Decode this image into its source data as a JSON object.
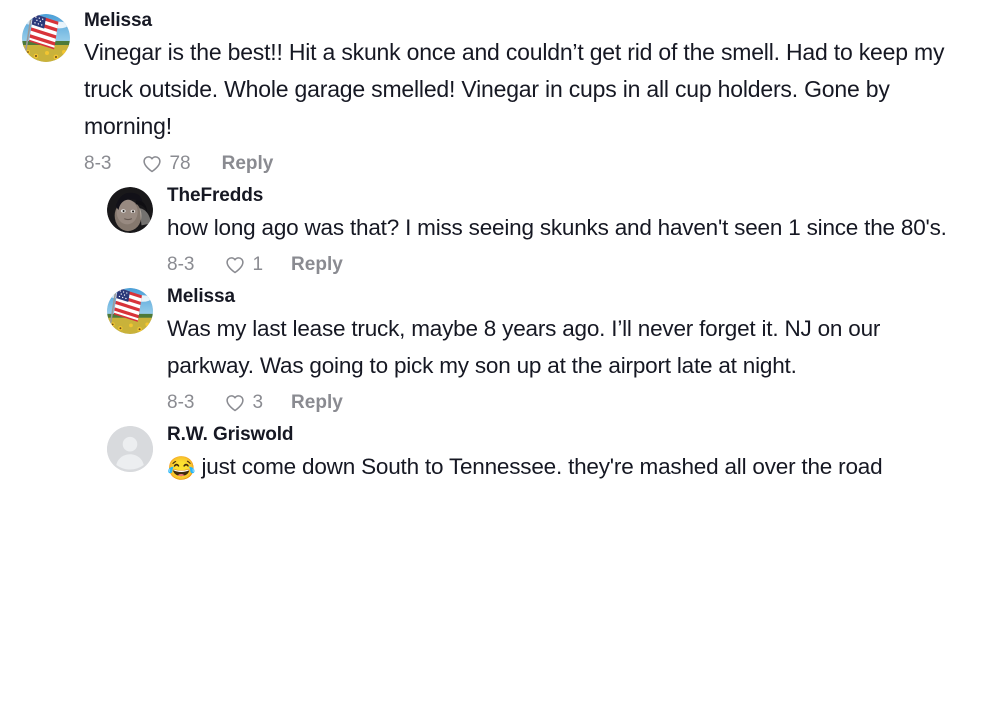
{
  "thread": {
    "comments": [
      {
        "level": 0,
        "avatar_type": "flag-field-photo",
        "username": "Melissa",
        "text": "Vinegar is the best!! Hit a skunk once and couldn’t get rid of the smell. Had to keep my truck outside. Whole garage smelled! Vinegar in cups in all cup holders. Gone by morning!",
        "emoji": "",
        "date": "8-3",
        "like_count": "78",
        "reply_label": "Reply",
        "like_icon": "heart-icon"
      },
      {
        "level": 1,
        "avatar_type": "dark-portrait-photo",
        "username": "TheFredds",
        "text": "how long ago was that? I miss seeing skunks and haven't seen 1 since the 80's.",
        "emoji": "",
        "date": "8-3",
        "like_count": "1",
        "reply_label": "Reply",
        "like_icon": "heart-icon"
      },
      {
        "level": 1,
        "avatar_type": "flag-field-photo",
        "username": "Melissa",
        "text": "Was my last lease truck, maybe 8 years ago. I’ll never forget it. NJ on our parkway. Was going to pick my son up at the airport late at night.",
        "emoji": "",
        "date": "8-3",
        "like_count": "3",
        "reply_label": "Reply",
        "like_icon": "heart-icon"
      },
      {
        "level": 1,
        "avatar_type": "default-person-placeholder",
        "username": "R.W. Griswold",
        "emoji": "😂",
        "text": " just come down South to Tennessee. they're mashed all over the road",
        "date": "",
        "like_count": "",
        "reply_label": "",
        "like_icon": ""
      }
    ]
  },
  "colors": {
    "text": "#161823",
    "muted": "#8a8b91",
    "background": "#ffffff",
    "placeholder_avatar": "#d8dadd"
  }
}
